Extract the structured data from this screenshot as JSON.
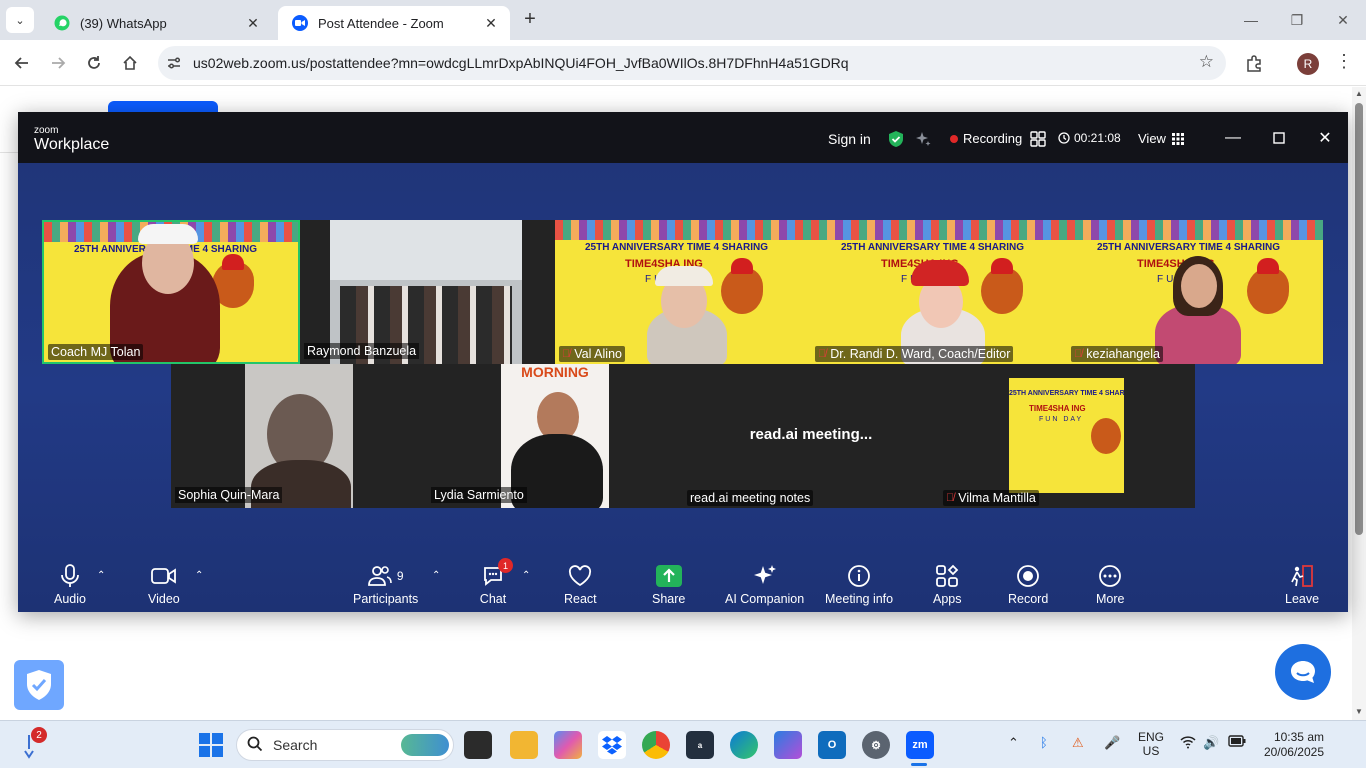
{
  "browser": {
    "tabs": [
      {
        "title": "(39) WhatsApp",
        "favicon": "whatsapp-icon",
        "active": false
      },
      {
        "title": "Post Attendee - Zoom",
        "favicon": "zoom-icon",
        "active": true
      }
    ],
    "url": "us02web.zoom.us/postattendee?mn=owdcgLLmrDxpAbINQUi4FOH_JvfBa0WIlOs.8H7DFhnH4a51GDRq",
    "profile_initial": "R"
  },
  "zoom": {
    "brand_small": "zoom",
    "brand_big": "Workplace",
    "sign_in": "Sign in",
    "recording": "Recording",
    "timer": "00:21:08",
    "view": "View",
    "accent": "#0b5cff",
    "participants_top": [
      {
        "name": "Coach MJ Tolan",
        "muted": false
      },
      {
        "name": "Raymond Banzuela",
        "muted": false
      },
      {
        "name": "Val Alino",
        "muted": true
      },
      {
        "name": "Dr. Randi D. Ward, Coach/Editor",
        "muted": true
      },
      {
        "name": "keziahangela",
        "muted": true
      }
    ],
    "participants_bottom": [
      {
        "name": "Sophia Quin-Mara",
        "muted": false
      },
      {
        "name": "Lydia Sarmiento",
        "muted": false
      },
      {
        "name": "read.ai meeting notes",
        "muted": false
      },
      {
        "name": "Vilma Mantilla",
        "muted": true
      }
    ],
    "readai_placeholder": "read.ai meeting...",
    "lydia_banner_text": "MORNING",
    "banner": {
      "title": "25TH ANNIVERSARY TIME 4 SHARING",
      "sub": "TIME4SHA ING",
      "fun": "FUN DAY"
    },
    "toolbar": {
      "audio": "Audio",
      "video": "Video",
      "participants": "Participants",
      "participants_count": "9",
      "chat": "Chat",
      "chat_badge": "1",
      "react": "React",
      "share": "Share",
      "ai_companion": "AI Companion",
      "meeting_info": "Meeting info",
      "apps": "Apps",
      "record": "Record",
      "more": "More",
      "leave": "Leave"
    }
  },
  "taskbar": {
    "search": "Search",
    "widget_badge": "2",
    "lang_line1": "ENG",
    "lang_line2": "US",
    "time": "10:35 am",
    "date": "20/06/2025"
  }
}
